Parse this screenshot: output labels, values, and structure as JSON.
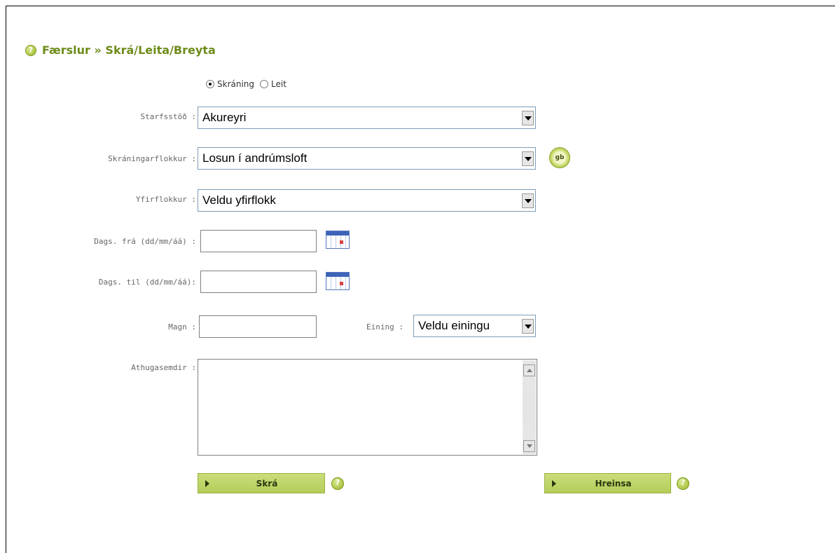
{
  "header": {
    "title": "Færslur » Skrá/Leita/Breyta"
  },
  "mode": {
    "options": [
      {
        "label": "Skráning",
        "checked": true
      },
      {
        "label": "Leit",
        "checked": false
      }
    ]
  },
  "form": {
    "starfsstod": {
      "label": "Starfsstöð :",
      "value": "Akureyri"
    },
    "skraningarflokkur": {
      "label": "Skráningarflokkur :",
      "value": "Losun í andrúmsloft"
    },
    "yfirflokkur": {
      "label": "Yfirflokkur :",
      "value": "Veldu yfirflokk"
    },
    "dags_fra": {
      "label": "Dags. frá (dd/mm/áá) :",
      "value": ""
    },
    "dags_til": {
      "label": "Dags. til (dd/mm/áá):",
      "value": ""
    },
    "magn": {
      "label": "Magn :",
      "value": ""
    },
    "eining": {
      "label": "Eining :",
      "value": "Veldu einingu"
    },
    "athugasemdir": {
      "label": "Athugasemdir :",
      "value": ""
    }
  },
  "icons": {
    "gb_badge_text": "gb",
    "help_glyph": "?"
  },
  "buttons": {
    "skra_label": "Skrá",
    "hreinsa_label": "Hreinsa"
  },
  "colors": {
    "accent": "#6e8c1a",
    "button_bg": "#c2d76e"
  }
}
